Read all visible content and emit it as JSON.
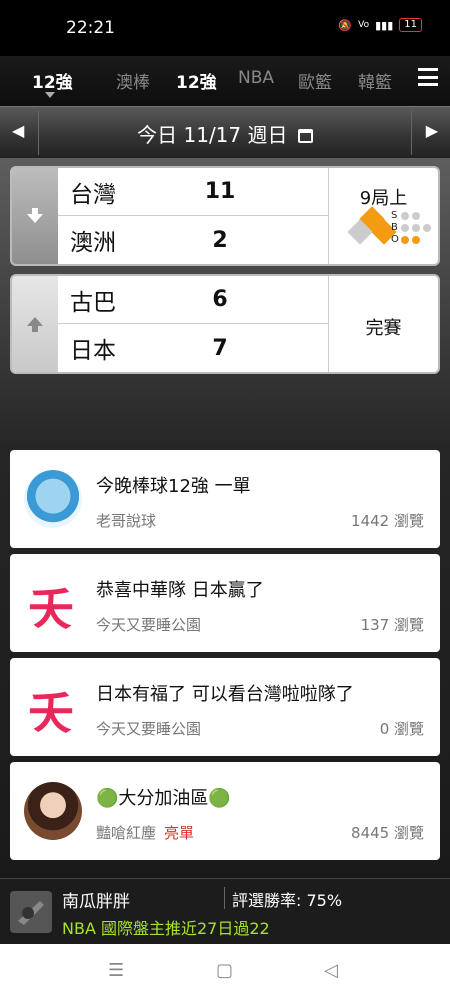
{
  "status_bar": {
    "time": "22:21",
    "battery": "11"
  },
  "tabs": [
    "12強",
    "澳棒",
    "12強",
    "NBA",
    "歐籃",
    "韓籃"
  ],
  "datebar": {
    "prev": "◀",
    "next": "▶",
    "date": "今日 11/17 週日"
  },
  "games": [
    {
      "home": "台灣",
      "home_score": "11",
      "away": "澳洲",
      "away_score": "2",
      "status": "9局上",
      "sbo_letters": [
        "S",
        "B",
        "O"
      ]
    },
    {
      "home": "古巴",
      "home_score": "6",
      "away": "日本",
      "away_score": "7",
      "status": "完賽"
    }
  ],
  "posts": [
    {
      "title": "今晚棒球12強 一單",
      "author": "老哥說球",
      "tag": "",
      "views": "1442 瀏覽"
    },
    {
      "title": "恭喜中華隊 日本贏了",
      "author": "今天又要睡公園",
      "tag": "",
      "views": "137 瀏覽"
    },
    {
      "title": "日本有福了 可以看台灣啦啦隊了",
      "author": "今天又要睡公園",
      "tag": "",
      "views": "0 瀏覽"
    },
    {
      "title": "🟢大分加油區🟢",
      "author": "豔嗆紅塵",
      "tag": "亮單",
      "views": "8445 瀏覽"
    }
  ],
  "avatar_glyph": "夭",
  "bottom_bar": {
    "name": "南瓜胖胖",
    "rate": "評選勝率: 75%",
    "promo": "NBA 國際盤主推近27日過22"
  },
  "colors": {
    "accent_orange": "#f39c12",
    "tian_red": "#e8285a",
    "promo_green": "#a6e22e",
    "tag_red": "#e0332a"
  }
}
